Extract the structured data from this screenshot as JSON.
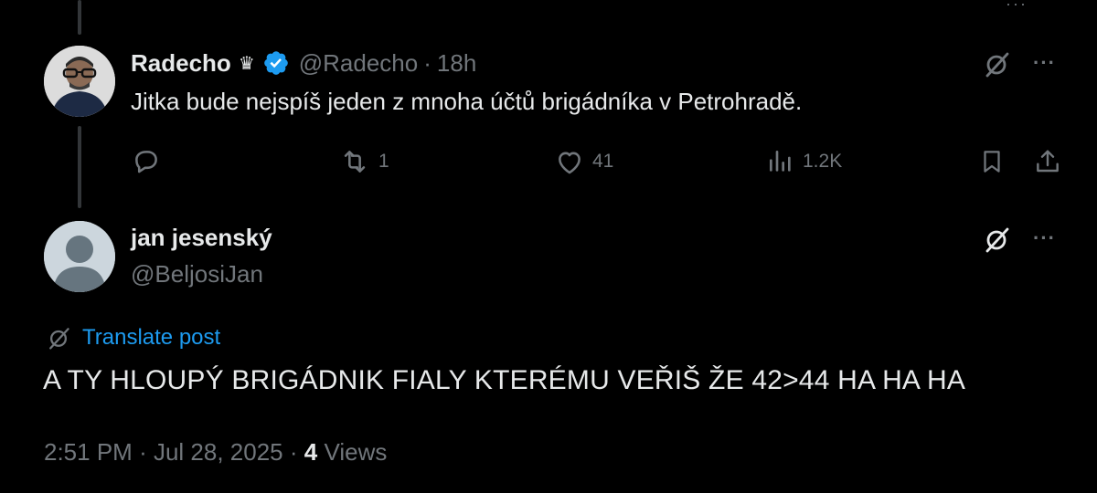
{
  "colors": {
    "background": "#000000",
    "text_primary": "#e7e9ea",
    "text_secondary": "#71767b",
    "accent": "#1d9bf0",
    "thread_line": "#333639"
  },
  "reply": {
    "display_name": "Radecho",
    "name_badge": "♛",
    "verified_icon": "verified-badge-icon",
    "handle": "@Radecho",
    "separator": "·",
    "time": "18h",
    "text": "Jitka bude nejspíš jeden z mnoha účtů brigádníka v Petrohradě.",
    "actions": {
      "reply_count": "",
      "repost_count": "1",
      "like_count": "41",
      "views_count": "1.2K"
    }
  },
  "post": {
    "display_name": "jan jesenský",
    "handle": "@BeljosiJan",
    "translate_label": "Translate post",
    "text": "A TY HLOUPÝ BRIGÁDNIK FIALY KTERÉMU VEŘIŠ ŽE 42>44 HA HA HA",
    "time": "2:51 PM",
    "date": "Jul 28, 2025",
    "separator": "·",
    "views_count": "4",
    "views_label": "Views"
  },
  "more_label": "···"
}
